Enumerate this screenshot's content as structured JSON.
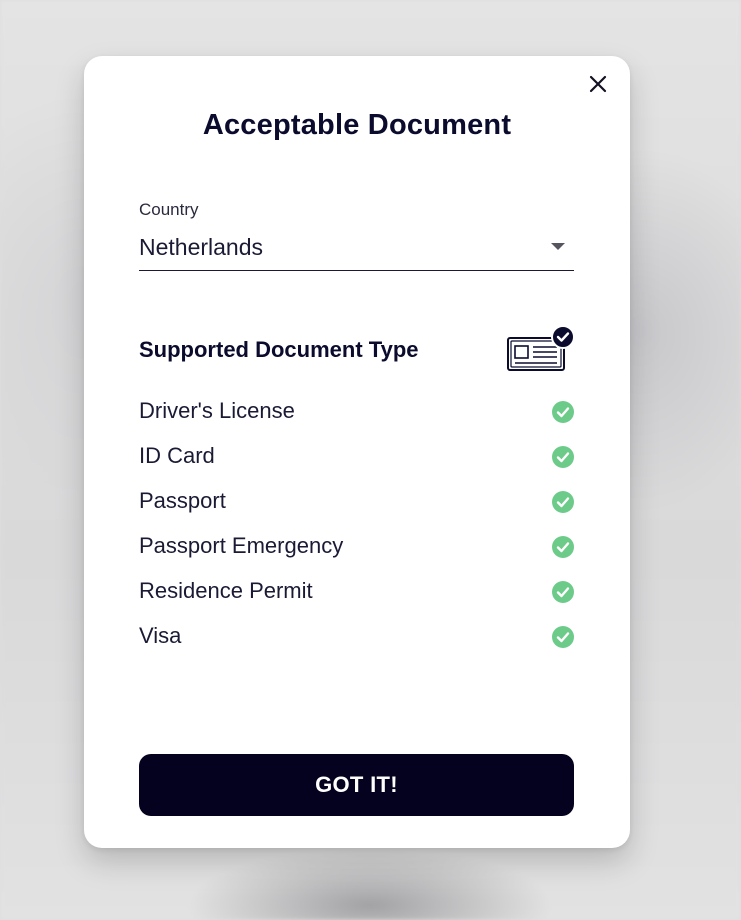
{
  "modal": {
    "title": "Acceptable Document",
    "close_icon": "close-icon"
  },
  "country": {
    "label": "Country",
    "selected": "Netherlands",
    "dropdown_icon": "chevron-down-icon"
  },
  "documents": {
    "heading": "Supported Document Type",
    "heading_icon": "id-card-check-icon",
    "items": [
      {
        "label": "Driver's License",
        "supported": true
      },
      {
        "label": "ID Card",
        "supported": true
      },
      {
        "label": "Passport",
        "supported": true
      },
      {
        "label": "Passport Emergency",
        "supported": true
      },
      {
        "label": "Residence Permit",
        "supported": true
      },
      {
        "label": "Visa",
        "supported": true
      }
    ],
    "check_icon": "check-circle-icon"
  },
  "actions": {
    "confirm_label": "GOT IT!"
  },
  "colors": {
    "primary": "#04021f",
    "check_green": "#6dcb8a",
    "text_dark": "#1a1a35"
  }
}
